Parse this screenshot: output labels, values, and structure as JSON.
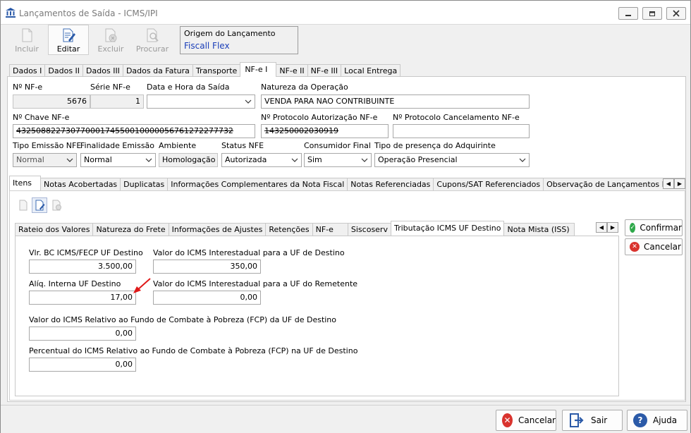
{
  "window": {
    "title": "Lançamentos de Saída - ICMS/IPI"
  },
  "toolbar": {
    "incluir": "Incluir",
    "editar": "Editar",
    "excluir": "Excluir",
    "procurar": "Procurar",
    "origin_label": "Origem do Lançamento",
    "origin_value": "Fiscall Flex"
  },
  "top_tabs": [
    "Dados I",
    "Dados II",
    "Dados III",
    "Dados da Fatura",
    "Transporte",
    "NF-e I",
    "NF-e II",
    "NF-e III",
    "Local Entrega"
  ],
  "form": {
    "nf_label": "Nº NF-e",
    "nf_value": "5676",
    "serie_label": "Série NF-e",
    "serie_value": "1",
    "data_label": "Data e Hora da Saída",
    "data_value": "",
    "natureza_label": "Natureza da Operação",
    "natureza_value": "VENDA PARA NAO CONTRIBUINTE",
    "chave_label": "Nº Chave NF-e",
    "chave_value": "43250882273077000174550010000056761272277732",
    "prot_aut_label": "Nº Protocolo Autorização NF-e",
    "prot_aut_value": "143250002030919",
    "prot_canc_label": "Nº Protocolo Cancelamento NF-e",
    "prot_canc_value": "",
    "tipo_emissao_label": "Tipo Emissão NFE",
    "tipo_emissao_value": "Normal",
    "finalidade_label": "Finalidade Emissão",
    "finalidade_value": "Normal",
    "ambiente_label": "Ambiente",
    "ambiente_value": "Homologação",
    "status_label": "Status NFE",
    "status_value": "Autorizada",
    "consumidor_label": "Consumidor Final",
    "consumidor_value": "Sim",
    "presenca_label": "Tipo de presença do Adquirinte",
    "presenca_value": "Operação Presencial"
  },
  "mid_tabs": [
    "Itens",
    "Notas Acobertadas",
    "Duplicatas",
    "Informações Complementares da Nota Fiscal",
    "Notas Referenciadas",
    "Cupons/SAT Referenciados",
    "Observação de Lançamentos Fiscais (C"
  ],
  "inner_tabs": [
    "Rateio dos Valores",
    "Natureza do Frete",
    "Informações de Ajustes",
    "Retenções",
    "NF-e",
    "Siscoserv",
    "Tributação ICMS UF Destino",
    "Nota Mista (ISS)"
  ],
  "icms": {
    "bc_label": "Vlr. BC ICMS/FECP UF Destino",
    "bc_value": "3.500,00",
    "inter_dest_label": "Valor do ICMS Interestadual para a UF de Destino",
    "inter_dest_value": "350,00",
    "aliq_label": "Alíq. Interna UF Destino",
    "aliq_value": "17,00",
    "inter_rem_label": "Valor do ICMS Interestadual para a UF do Remetente",
    "inter_rem_value": "0,00",
    "fcp_label": "Valor do ICMS Relativo ao Fundo de Combate à Pobreza (FCP) da UF de Destino",
    "fcp_value": "0,00",
    "perc_fcp_label": "Percentual do ICMS Relativo ao Fundo de Combate à Pobreza (FCP) na UF de Destino",
    "perc_fcp_value": "0,00"
  },
  "side": {
    "confirmar": "Confirmar",
    "cancelar": "Cancelar"
  },
  "bottom": {
    "cancelar": "Cancelar",
    "sair": "Sair",
    "ajuda": "Ajuda"
  }
}
